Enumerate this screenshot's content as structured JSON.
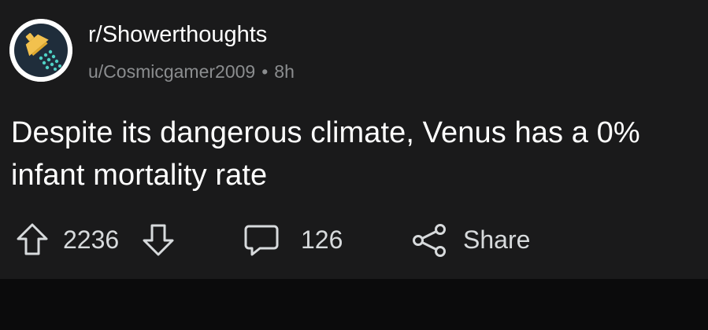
{
  "post": {
    "subreddit": "r/Showerthoughts",
    "author": "u/Cosmicgamer2009",
    "separator": "•",
    "age": "8h",
    "title": "Despite its dangerous climate, Venus has a 0% infant mortality rate",
    "avatar_icon": "lightbulb-shower-icon"
  },
  "actions": {
    "score": "2236",
    "upvote_icon": "upvote-arrow-icon",
    "downvote_icon": "downvote-arrow-icon",
    "comment_icon": "comment-bubble-icon",
    "comment_count": "126",
    "share_icon": "share-icon",
    "share_label": "Share"
  },
  "colors": {
    "background": "#1a1a1b",
    "text": "#ffffff",
    "muted": "#8b8d8f",
    "icon": "#d7dadc",
    "avatar_ring": "#1f2d3b"
  }
}
